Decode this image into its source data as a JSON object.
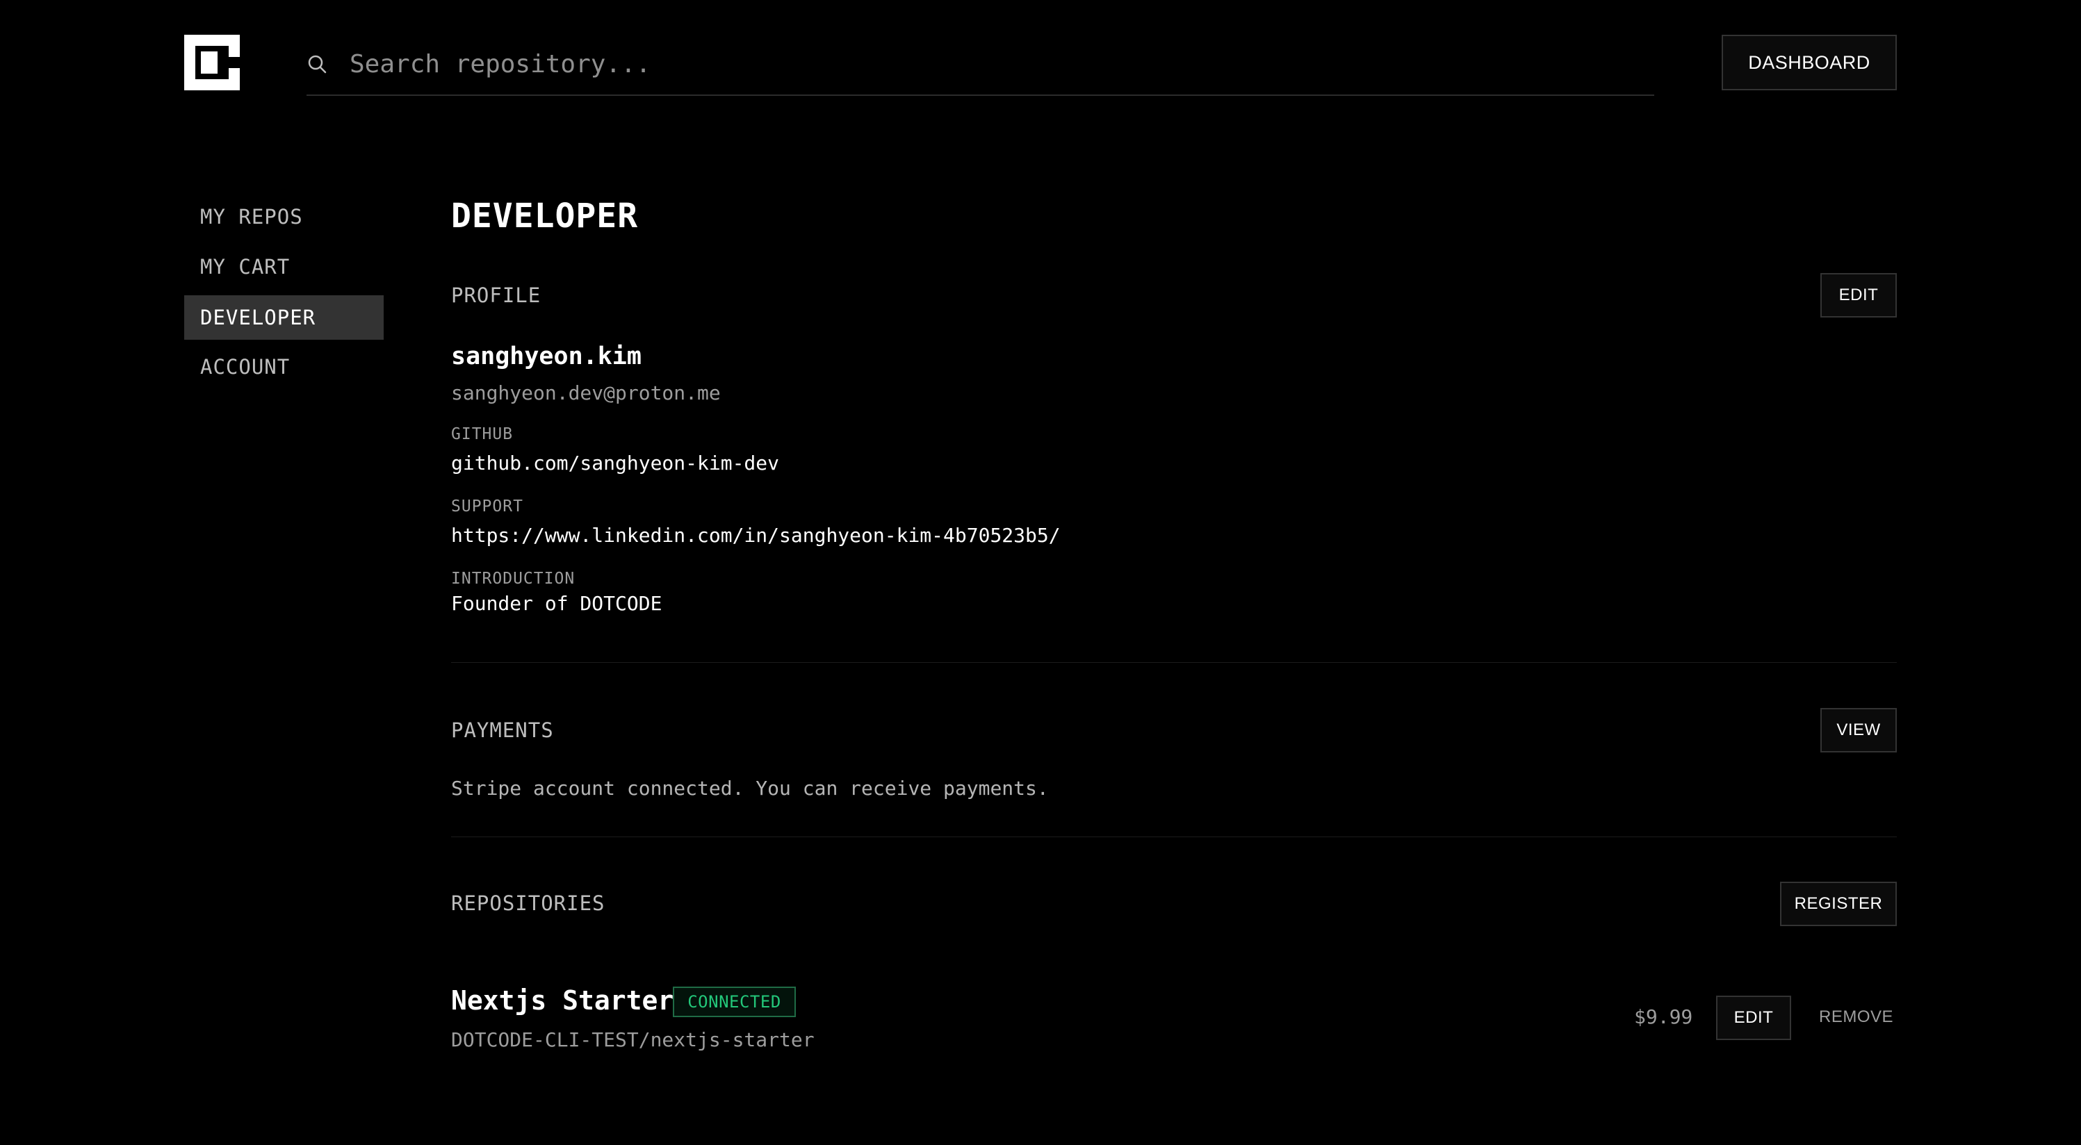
{
  "header": {
    "logo_icon": "dotcode-logo-icon",
    "search": {
      "icon": "search-icon",
      "placeholder": "Search repository...",
      "value": ""
    },
    "dashboard_label": "DASHBOARD"
  },
  "sidebar": {
    "items": [
      {
        "label": "MY REPOS",
        "active": false
      },
      {
        "label": "MY CART",
        "active": false
      },
      {
        "label": "DEVELOPER",
        "active": true
      },
      {
        "label": "ACCOUNT",
        "active": false
      }
    ]
  },
  "main": {
    "title": "DEVELOPER",
    "profile": {
      "section_title": "PROFILE",
      "edit_label": "EDIT",
      "name": "sanghyeon.kim",
      "email": "sanghyeon.dev@proton.me",
      "github_label": "GITHUB",
      "github_value": "github.com/sanghyeon-kim-dev",
      "support_label": "SUPPORT",
      "support_value": "https://www.linkedin.com/in/sanghyeon-kim-4b70523b5/",
      "introduction_label": "INTRODUCTION",
      "introduction_value": "Founder of DOTCODE"
    },
    "payments": {
      "section_title": "PAYMENTS",
      "view_label": "VIEW",
      "status_text": "Stripe account connected. You can receive payments."
    },
    "repositories": {
      "section_title": "REPOSITORIES",
      "register_label": "REGISTER",
      "items": [
        {
          "name": "Nextjs Starter",
          "badge": "CONNECTED",
          "path": "DOTCODE-CLI-TEST/nextjs-starter",
          "price": "$9.99",
          "edit_label": "EDIT",
          "remove_label": "REMOVE"
        }
      ]
    }
  },
  "colors": {
    "background": "#000000",
    "active_nav": "#333333",
    "badge_green": "#23c77a"
  }
}
